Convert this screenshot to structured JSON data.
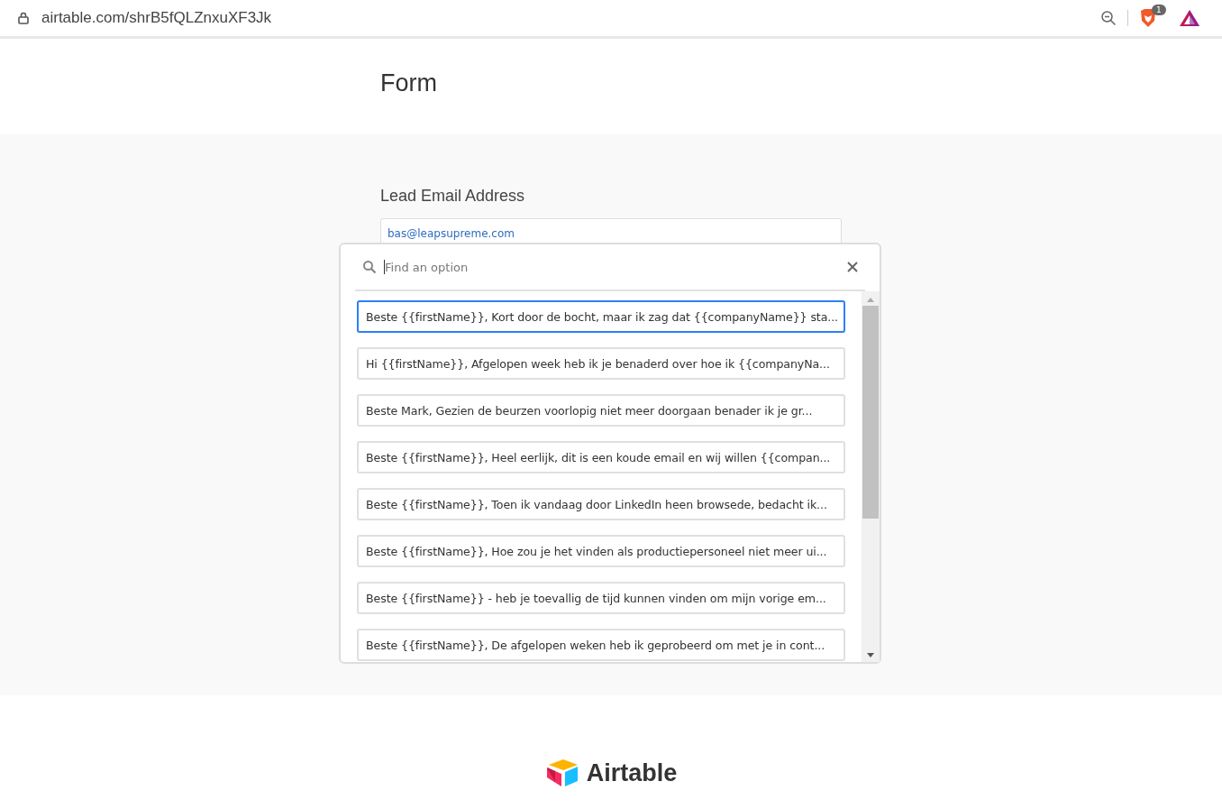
{
  "browser": {
    "url": "airtable.com/shrB5fQLZnxuXF3Jk",
    "badge": "1"
  },
  "form": {
    "title": "Form"
  },
  "field": {
    "label": "Lead Email Address",
    "value": "bas@leapsupreme.com"
  },
  "dropdown": {
    "search_placeholder": "Find an option",
    "options": [
      {
        "text": "Beste {{firstName}}, Kort door de bocht, maar ik zag dat {{companyName}} sta...",
        "selected": true
      },
      {
        "text": "Hi {{firstName}}, Afgelopen week heb ik je benaderd over hoe ik {{companyNa...",
        "selected": false
      },
      {
        "text": "Beste Mark, Gezien de beurzen voorlopig niet meer doorgaan benader ik je gr...",
        "selected": false
      },
      {
        "text": "Beste {{firstName}}, Heel eerlijk, dit is een koude email en wij willen {{compan...",
        "selected": false
      },
      {
        "text": "Beste {{firstName}}, Toen ik vandaag door LinkedIn heen browsede, bedacht ik...",
        "selected": false
      },
      {
        "text": "Beste {{firstName}}, Hoe zou je het vinden als productiepersoneel niet meer ui...",
        "selected": false
      },
      {
        "text": "Beste {{firstName}} - heb je toevallig de tijd kunnen vinden om mijn vorige em...",
        "selected": false
      },
      {
        "text": "Beste {{firstName}}, De afgelopen weken heb ik geprobeerd om met je in cont...",
        "selected": false
      }
    ]
  },
  "footer": {
    "brand": "Airtable"
  }
}
